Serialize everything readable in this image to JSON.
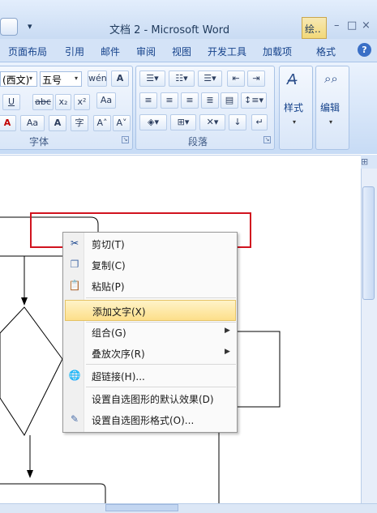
{
  "window": {
    "title": "文档 2 - Microsoft Word",
    "contextual_tab": "绘..",
    "controls": [
      "–",
      "□",
      "×"
    ]
  },
  "tabs": [
    "页面布局",
    "引用",
    "邮件",
    "审阅",
    "视图",
    "开发工具",
    "加载项",
    "格式"
  ],
  "ribbon": {
    "font_group": {
      "label": "字体",
      "font_name": "(西文)",
      "font_size": "五号",
      "wen_button": "wén",
      "a_box_button": "A",
      "underline": "U",
      "strike": "abc",
      "subscript": "x₂",
      "superscript": "x²",
      "clear_format": "Aa",
      "text_highlight": "A",
      "change_case": "Aa",
      "char_border": "A",
      "enclose_char": "字",
      "grow_font": "A˄",
      "shrink_font": "A˅"
    },
    "paragraph_group": {
      "label": "段落"
    },
    "styles_group": {
      "label": "样式"
    },
    "editing_group": {
      "label": "编辑"
    }
  },
  "context_menu": {
    "items": [
      {
        "label": "剪切(T)",
        "icon": "scissors-icon",
        "submenu": false,
        "highlighted": false
      },
      {
        "label": "复制(C)",
        "icon": "copy-icon",
        "submenu": false,
        "highlighted": false
      },
      {
        "label": "粘贴(P)",
        "icon": "paste-icon",
        "submenu": false,
        "highlighted": false
      },
      {
        "label": "添加文字(X)",
        "icon": "",
        "submenu": false,
        "highlighted": true
      },
      {
        "label": "组合(G)",
        "icon": "",
        "submenu": true,
        "highlighted": false
      },
      {
        "label": "叠放次序(R)",
        "icon": "",
        "submenu": true,
        "highlighted": false
      },
      {
        "label": "超链接(H)...",
        "icon": "hyperlink-globe-icon",
        "submenu": false,
        "highlighted": false
      },
      {
        "label": "设置自选图形的默认效果(D)",
        "icon": "",
        "submenu": false,
        "highlighted": false
      },
      {
        "label": "设置自选图形格式(O)...",
        "icon": "format-shape-icon",
        "submenu": false,
        "highlighted": false
      }
    ]
  },
  "colors": {
    "highlight_box": "#d1131f",
    "menu_hover": "#fddf8a",
    "ribbon_bg": "#c7dbf5"
  }
}
